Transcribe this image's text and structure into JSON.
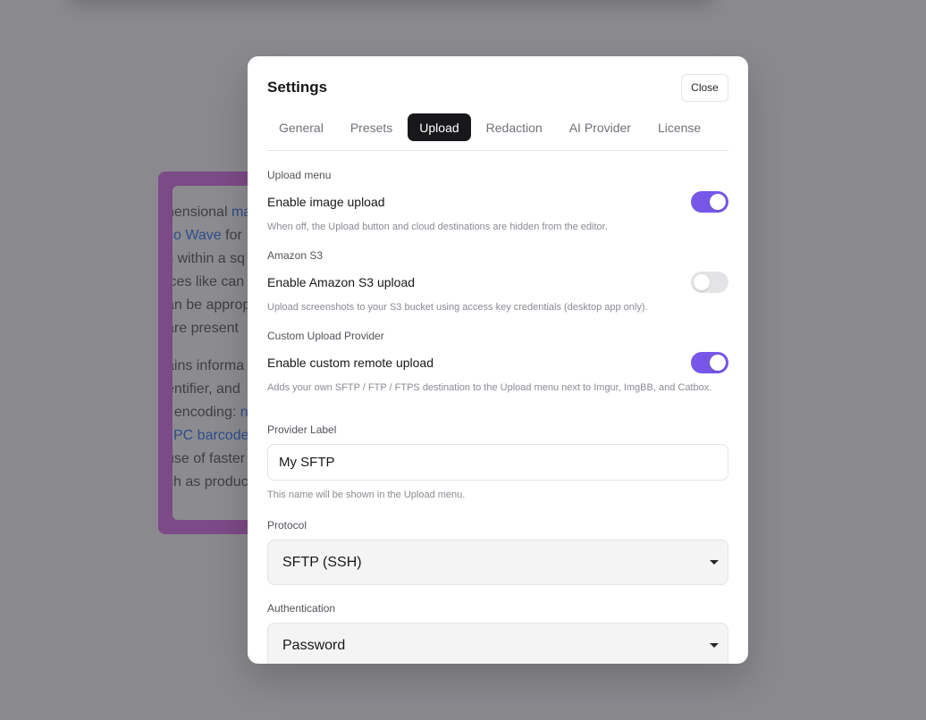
{
  "background": {
    "lines": [
      {
        "text": "nensional ",
        "link": "ma"
      },
      {
        "text": "",
        "link": "so Wave",
        "after": " for"
      },
      {
        "text": "s within a sq"
      },
      {
        "text": "ices like can"
      },
      {
        "text": "an be approp"
      },
      {
        "text": "are present"
      },
      {
        "gap": true
      },
      {
        "text": "ains informa"
      },
      {
        "text": "entifier, and"
      },
      {
        "text": "f encoding: ",
        "link": "n"
      },
      {
        "text": "",
        "link": "JPC barcode"
      },
      {
        "text": "use of faster"
      },
      {
        "text": "ch as produc"
      }
    ]
  },
  "modal": {
    "title": "Settings",
    "close_label": "Close",
    "tabs": [
      {
        "label": "General"
      },
      {
        "label": "Presets"
      },
      {
        "label": "Upload",
        "active": true
      },
      {
        "label": "Redaction"
      },
      {
        "label": "AI Provider"
      },
      {
        "label": "License"
      }
    ],
    "upload_menu": {
      "section": "Upload menu",
      "toggle_label": "Enable image upload",
      "enabled": true,
      "help": "When off, the Upload button and cloud destinations are hidden from the editor."
    },
    "amazon_s3": {
      "section": "Amazon S3",
      "toggle_label": "Enable Amazon S3 upload",
      "enabled": false,
      "help": "Upload screenshots to your S3 bucket using access key credentials (desktop app only)."
    },
    "custom_provider": {
      "section": "Custom Upload Provider",
      "toggle_label": "Enable custom remote upload",
      "enabled": true,
      "help": "Adds your own SFTP / FTP / FTPS destination to the Upload menu next to Imgur, ImgBB, and Catbox."
    },
    "provider_label": {
      "label": "Provider Label",
      "value": "My SFTP",
      "help": "This name will be shown in the Upload menu."
    },
    "protocol": {
      "label": "Protocol",
      "value": "SFTP (SSH)"
    },
    "authentication": {
      "label": "Authentication",
      "value": "Password"
    },
    "colors": {
      "accent": "#7657e8",
      "tab_active_bg": "#18181b"
    }
  }
}
